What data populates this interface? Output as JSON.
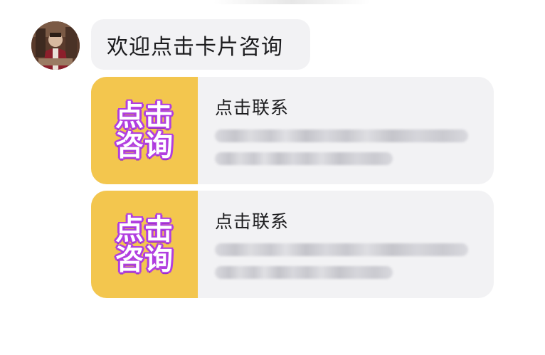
{
  "message": {
    "text": "欢迎点击卡片咨询"
  },
  "cards": [
    {
      "thumb_line1": "点击",
      "thumb_line2": "咨询",
      "title": "点击联系"
    },
    {
      "thumb_line1": "点击",
      "thumb_line2": "咨询",
      "title": "点击联系"
    }
  ],
  "colors": {
    "bubble_bg": "#f2f2f4",
    "thumb_bg": "#f3c64e",
    "thumb_text_outline": "#b13ee0"
  },
  "icons": {
    "avatar": "user-avatar-photo"
  }
}
